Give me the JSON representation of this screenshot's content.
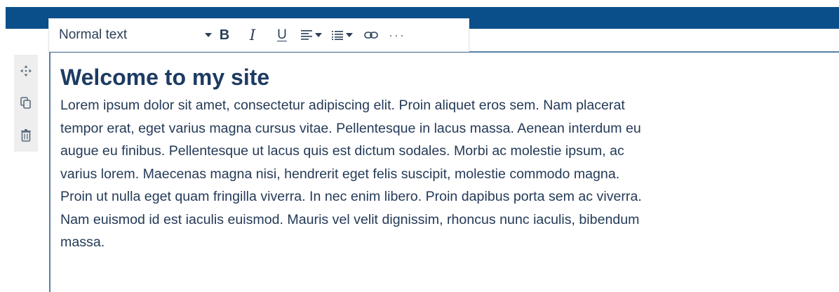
{
  "toolbar": {
    "text_style": "Normal text",
    "bold_label": "B",
    "italic_label": "I",
    "underline_label": "U",
    "more_label": "···",
    "icons": [
      "chevron-down-icon",
      "align-left-icon",
      "list-icon",
      "link-icon",
      "more-icon"
    ]
  },
  "side_tools": {
    "icons": [
      "move-icon",
      "duplicate-icon",
      "delete-icon"
    ]
  },
  "content": {
    "title": "Welcome to my site",
    "paragraph_lines": [
      "Lorem ipsum dolor sit amet, consectetur adipiscing elit. Proin aliquet eros sem. Nam placerat",
      "tempor erat, eget varius magna cursus vitae. Pellentesque in lacus massa. Aenean interdum eu",
      "augue eu finibus. Pellentesque ut lacus quis est dictum sodales. Morbi ac molestie ipsum, ac",
      "varius lorem. Maecenas magna nisi, hendrerit eget felis suscipit, molestie commodo magna.",
      "Proin ut nulla eget quam fringilla viverra. In nec enim libero. Proin dapibus porta sem ac viverra.",
      "Nam euismod id est iaculis euismod. Mauris vel velit dignissim, rhoncus nunc iaculis, bibendum",
      "massa."
    ]
  },
  "colors": {
    "top_bar": "#0b4f8a",
    "text": "#243a57",
    "heading": "#1d3b62",
    "spellcheck_underline": "#e53935"
  }
}
